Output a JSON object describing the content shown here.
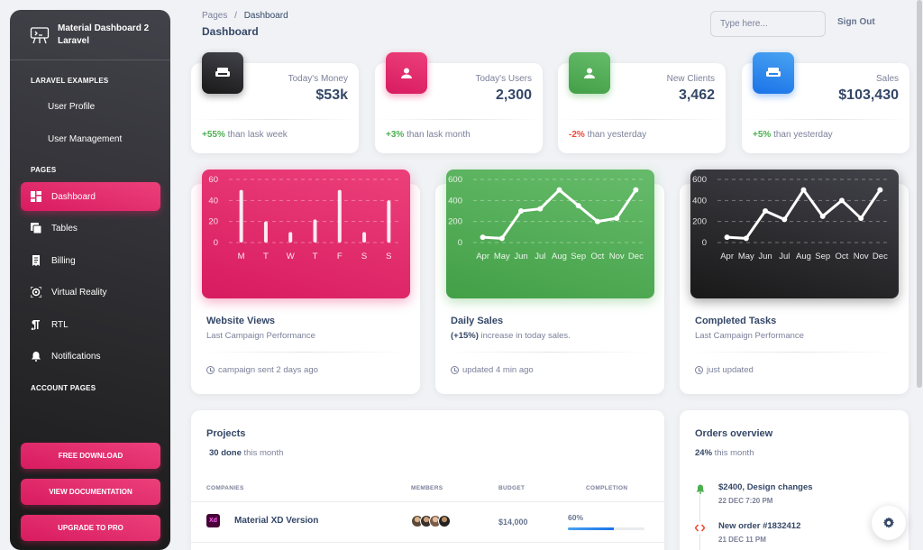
{
  "sidebar": {
    "brand_line1": "Material Dashboard 2",
    "brand_line2": "Laravel",
    "section_examples": "LARAVEL EXAMPLES",
    "user_profile": "User Profile",
    "user_management": "User Management",
    "section_pages": "PAGES",
    "items": [
      {
        "label": "Dashboard",
        "icon": "dashboard-icon"
      },
      {
        "label": "Tables",
        "icon": "tables-icon"
      },
      {
        "label": "Billing",
        "icon": "billing-icon"
      },
      {
        "label": "Virtual Reality",
        "icon": "virtual-reality-icon"
      },
      {
        "label": "RTL",
        "icon": "rtl-icon"
      },
      {
        "label": "Notifications",
        "icon": "notifications-icon"
      }
    ],
    "section_account": "ACCOUNT PAGES",
    "btn_download": "FREE DOWNLOAD",
    "btn_docs": "VIEW DOCUMENTATION",
    "btn_pro": "UPGRADE TO PRO"
  },
  "header": {
    "crumb_root": "Pages",
    "crumb_sep": "/",
    "crumb_current": "Dashboard",
    "title": "Dashboard",
    "search_placeholder": "Type here...",
    "sign_out": "Sign Out"
  },
  "stats": [
    {
      "label": "Today's Money",
      "value": "$53k",
      "change": "+55%",
      "note": "than lask week",
      "color": "#4caf50",
      "icon": "weekend-icon"
    },
    {
      "label": "Today's Users",
      "value": "2,300",
      "change": "+3%",
      "note": "than lask month",
      "color": "#4caf50",
      "icon": "person-icon"
    },
    {
      "label": "New Clients",
      "value": "3,462",
      "change": "-2%",
      "note": "than yesterday",
      "color": "#f44335",
      "icon": "person-icon"
    },
    {
      "label": "Sales",
      "value": "$103,430",
      "change": "+5%",
      "note": "than yesterday",
      "color": "#4caf50",
      "icon": "weekend-icon"
    }
  ],
  "charts": [
    {
      "title": "Website Views",
      "subtitle": "Last Campaign Performance",
      "footer": "campaign sent 2 days ago"
    },
    {
      "title": "Daily Sales",
      "subtitle_bold": "(+15%)",
      "subtitle_rest": " increase in today sales.",
      "footer": "updated 4 min ago"
    },
    {
      "title": "Completed Tasks",
      "subtitle": "Last Campaign Performance",
      "footer": "just updated"
    }
  ],
  "chart_data": [
    {
      "type": "bar",
      "categories": [
        "M",
        "T",
        "W",
        "T",
        "F",
        "S",
        "S"
      ],
      "values": [
        50,
        20,
        10,
        22,
        50,
        10,
        40
      ],
      "ylim": [
        0,
        60
      ],
      "yticks": [
        0,
        20,
        40,
        60
      ],
      "grid": true
    },
    {
      "type": "line",
      "categories": [
        "Apr",
        "May",
        "Jun",
        "Jul",
        "Aug",
        "Sep",
        "Oct",
        "Nov",
        "Dec"
      ],
      "values": [
        50,
        40,
        300,
        320,
        500,
        350,
        200,
        230,
        500
      ],
      "ylim": [
        0,
        600
      ],
      "yticks": [
        0,
        200,
        400,
        600
      ],
      "grid": true
    },
    {
      "type": "line",
      "categories": [
        "Apr",
        "May",
        "Jun",
        "Jul",
        "Aug",
        "Sep",
        "Oct",
        "Nov",
        "Dec"
      ],
      "values": [
        50,
        40,
        300,
        220,
        500,
        250,
        400,
        230,
        500
      ],
      "ylim": [
        0,
        600
      ],
      "yticks": [
        0,
        200,
        400,
        600
      ],
      "grid": true
    }
  ],
  "projects": {
    "title": "Projects",
    "done_bold": "30 done",
    "done_rest": " this month",
    "col_companies": "COMPANIES",
    "col_members": "MEMBERS",
    "col_budget": "BUDGET",
    "col_completion": "COMPLETION",
    "rows": [
      {
        "logo": "Xd",
        "name": "Material XD Version",
        "budget": "$14,000",
        "completion": "60%",
        "completion_value": 60
      }
    ]
  },
  "orders": {
    "title": "Orders overview",
    "sub_bold": "24%",
    "sub_rest": " this month",
    "items": [
      {
        "title": "$2400, Design changes",
        "date": "22 DEC 7:20 PM",
        "icon": "bell-icon",
        "color": "#4caf50"
      },
      {
        "title": "New order #1832412",
        "date": "21 DEC 11 PM",
        "icon": "code-icon",
        "color": "#f44335"
      }
    ]
  },
  "colors": {
    "primary": "#e91e63",
    "success": "#4caf50",
    "info": "#1a73e8",
    "dark": "#344767"
  }
}
